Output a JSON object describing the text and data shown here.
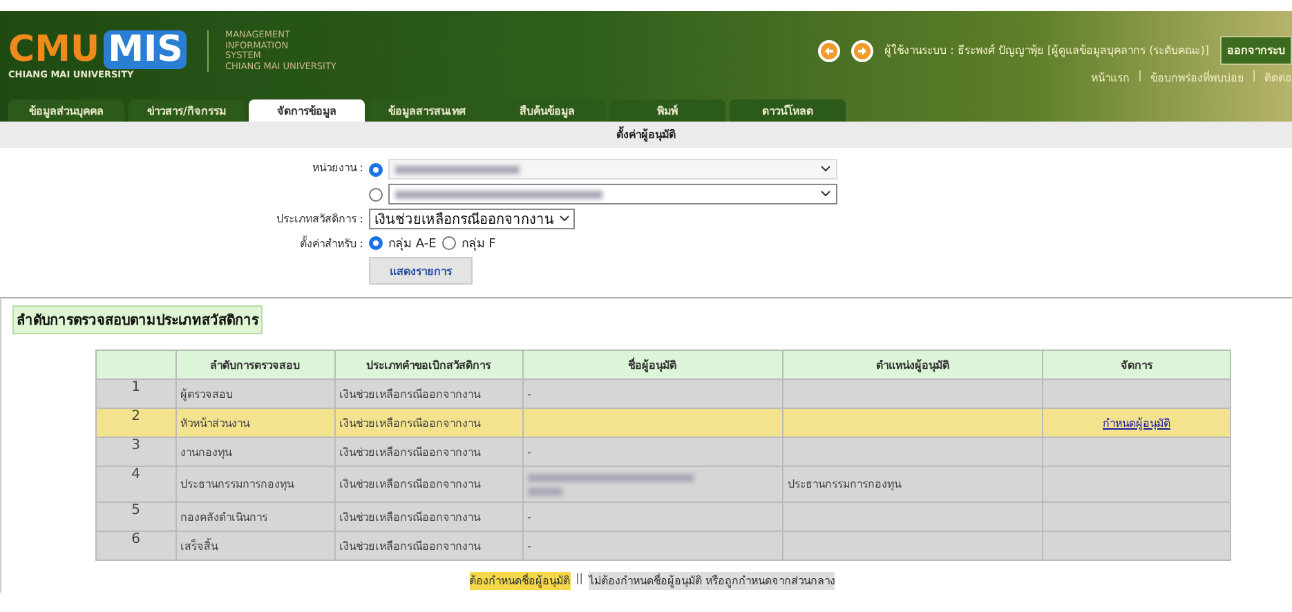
{
  "header": {
    "logo_main": "CMU",
    "logo_accent": "MIS",
    "logo_sub": "CHIANG MAI UNIVERSITY",
    "system_lines": [
      "MANAGEMENT",
      "INFORMATION",
      "SYSTEM",
      "CHIANG MAI UNIVERSITY"
    ],
    "user": "ผู้ใช้งานระบบ : ธีระพงศ์ ปัญญาพุ้ย [ผู้ดูแลข้อมูลบุคลากร (ระดับคณะ)]",
    "logout": "ออกจากระบ",
    "links": [
      "หน้าแรก",
      "ข้อบกพร่องที่พบบ่อย",
      "ติดต่อ"
    ],
    "link_separator": "|"
  },
  "tabs": [
    {
      "label": "ข้อมูลส่วนบุคคล",
      "selected": false
    },
    {
      "label": "ข่าวสาร/กิจกรรม",
      "selected": false
    },
    {
      "label": "จัดการข้อมูล",
      "selected": true
    },
    {
      "label": "ข้อมูลสารสนเทศ",
      "selected": false
    },
    {
      "label": "สืบค้นข้อมูล",
      "selected": false
    },
    {
      "label": "พิมพ์",
      "selected": false
    },
    {
      "label": "ดาวน์โหลด",
      "selected": false
    }
  ],
  "page_title": "ตั้งค่าผู้อนุมัติ",
  "form": {
    "unit_label": "หน่วยงาน :",
    "unit_options": [
      {
        "selected": true,
        "disabled": true
      },
      {
        "selected": false,
        "disabled": false
      }
    ],
    "welfare_label": "ประเภทสวัสดิการ :",
    "welfare_value": "เงินช่วยเหลือกรณีออกจากงาน",
    "group_label": "ตั้งค่าสำหรับ :",
    "groups": [
      {
        "label": "กลุ่ม A-E",
        "selected": true
      },
      {
        "label": "กลุ่ม F",
        "selected": false
      }
    ],
    "submit": "แสดงรายการ"
  },
  "section_title": "ลำดับการตรวจสอบตามประเภทสวัสดิการ",
  "table": {
    "columns": [
      "ลำดับการตรวจสอบ",
      "ประเภทคำขอเบิกสวัสดิการ",
      "ชื่อผู้อนุมัติ",
      "ตำแหน่งผู้อนุมัติ",
      "จัดการ"
    ],
    "rows": [
      {
        "no": "1",
        "step": "ผู้ตรวจสอบ",
        "type": "เงินช่วยเหลือกรณีออกจากงาน",
        "approver": "-",
        "position": "",
        "action": "",
        "required": false
      },
      {
        "no": "2",
        "step": "หัวหน้าส่วนงาน",
        "type": "เงินช่วยเหลือกรณีออกจากงาน",
        "approver": "",
        "position": "",
        "action": "กำหนดผู้อนุมัติ",
        "required": true
      },
      {
        "no": "3",
        "step": "งานกองทุน",
        "type": "เงินช่วยเหลือกรณีออกจากงาน",
        "approver": "-",
        "position": "",
        "action": "",
        "required": false
      },
      {
        "no": "4",
        "step": "ประธานกรรมการกองทุน",
        "type": "เงินช่วยเหลือกรณีออกจากงาน",
        "approver_redacted": true,
        "position": "ประธานกรรมการกองทุน",
        "action": "",
        "required": false
      },
      {
        "no": "5",
        "step": "กองคลังดำเนินการ",
        "type": "เงินช่วยเหลือกรณีออกจากงาน",
        "approver": "-",
        "position": "",
        "action": "",
        "required": false
      },
      {
        "no": "6",
        "step": "เสร็จสิ้น",
        "type": "เงินช่วยเหลือกรณีออกจากงาน",
        "approver": "-",
        "position": "",
        "action": "",
        "required": false
      }
    ]
  },
  "legend": {
    "required": "ต้องกำหนดชื่อผู้อนุมัติ",
    "separator": "||",
    "optional": "ไม่ต้องกำหนดชื่อผู้อนุมัติ หรือถูกกำหนดจากส่วนกลาง"
  }
}
